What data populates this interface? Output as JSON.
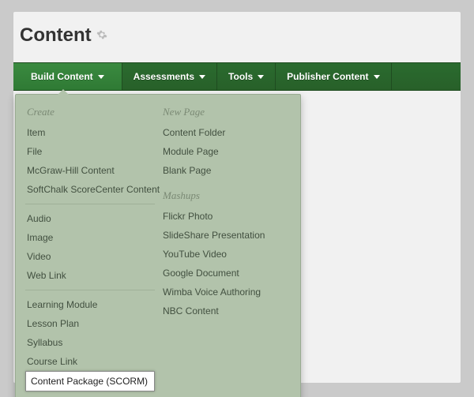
{
  "page": {
    "title": "Content"
  },
  "toolbar": {
    "buildContent": "Build Content",
    "assessments": "Assessments",
    "tools": "Tools",
    "publisherContent": "Publisher Content"
  },
  "dropdown": {
    "left": {
      "createHeader": "Create",
      "group1": {
        "item": "Item",
        "file": "File",
        "mcgraw": "McGraw-Hill Content",
        "softchalk": "SoftChalk ScoreCenter Content"
      },
      "group2": {
        "audio": "Audio",
        "image": "Image",
        "video": "Video",
        "weblink": "Web Link"
      },
      "group3": {
        "learningModule": "Learning Module",
        "lessonPlan": "Lesson Plan",
        "syllabus": "Syllabus",
        "courseLink": "Course Link",
        "scorm": "Content Package (SCORM)"
      }
    },
    "right": {
      "newPageHeader": "New Page",
      "newPage": {
        "contentFolder": "Content Folder",
        "modulePage": "Module Page",
        "blankPage": "Blank Page"
      },
      "mashupsHeader": "Mashups",
      "mashups": {
        "flickr": "Flickr Photo",
        "slideshare": "SlideShare Presentation",
        "youtube": "YouTube Video",
        "googledoc": "Google Document",
        "wimba": "Wimba Voice Authoring",
        "nbc": "NBC Content"
      }
    }
  }
}
